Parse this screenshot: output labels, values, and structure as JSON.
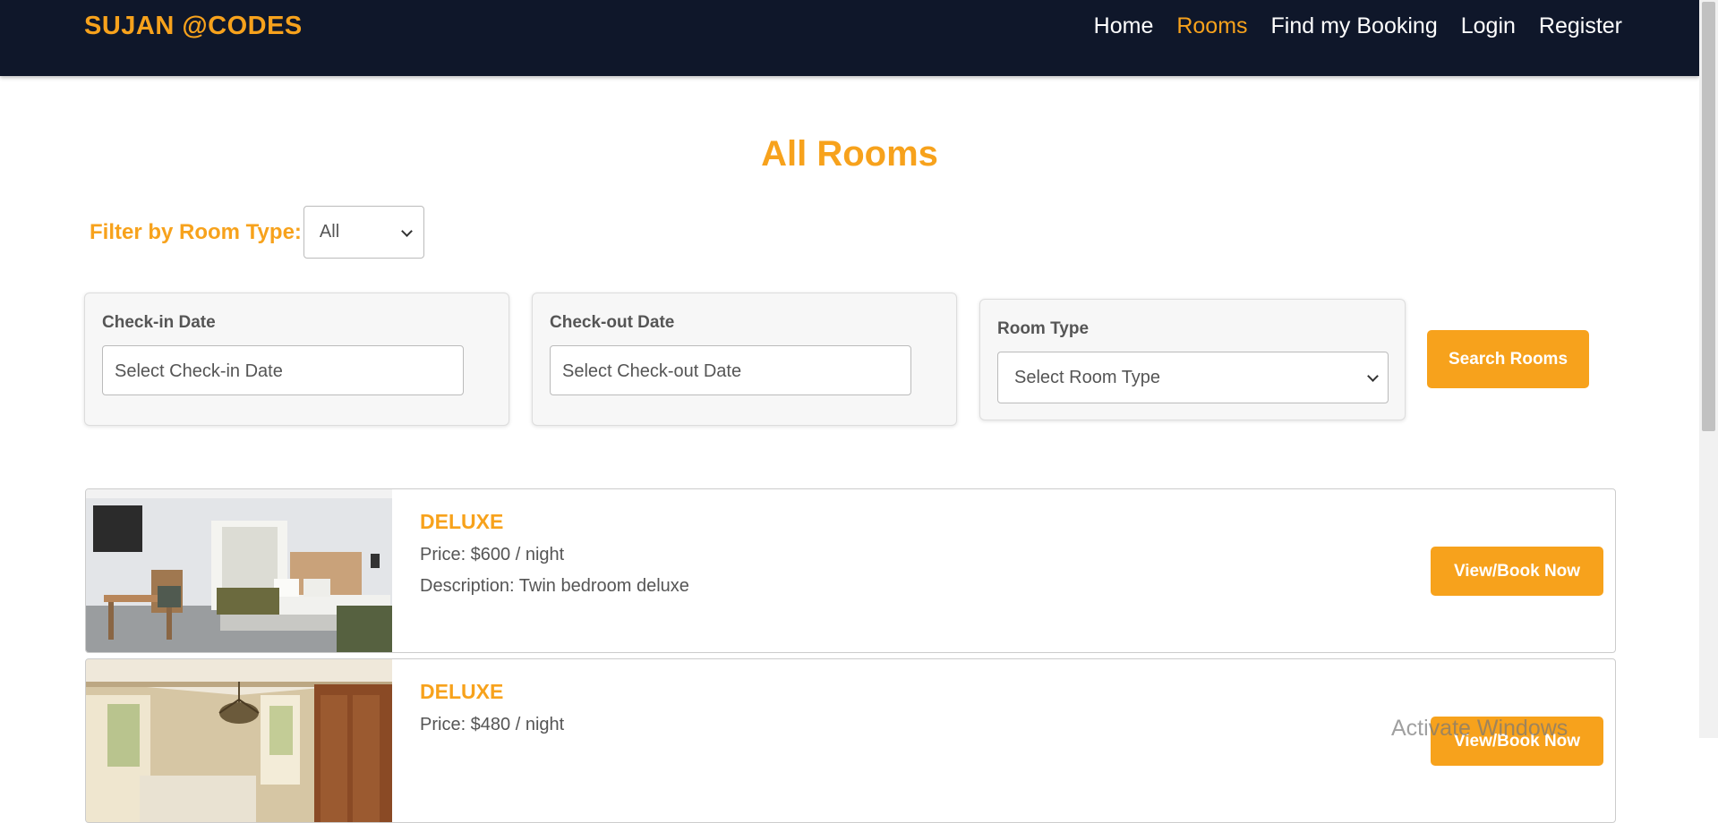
{
  "nav": {
    "brand": "SUJAN @CODES",
    "links": [
      "Home",
      "Rooms",
      "Find my Booking",
      "Login",
      "Register"
    ],
    "active": "Rooms"
  },
  "page": {
    "title": "All Rooms",
    "filter_label": "Filter by Room Type:",
    "filter_value": "All"
  },
  "search": {
    "checkin_label": "Check-in Date",
    "checkin_placeholder": "Select Check-in Date",
    "checkout_label": "Check-out Date",
    "checkout_placeholder": "Select Check-out Date",
    "roomtype_label": "Room Type",
    "roomtype_value": "Select Room Type",
    "button": "Search Rooms"
  },
  "rooms": [
    {
      "type": "DELUXE",
      "price": "Price: $600 / night",
      "description": "Description: Twin bedroom deluxe",
      "button": "View/Book Now"
    },
    {
      "type": "DELUXE",
      "price": "Price: $480 / night",
      "button": "View/Book Now"
    }
  ],
  "watermark": "Activate Windows",
  "colors": {
    "accent": "#f7a21c",
    "nav_bg": "#0f172a"
  }
}
